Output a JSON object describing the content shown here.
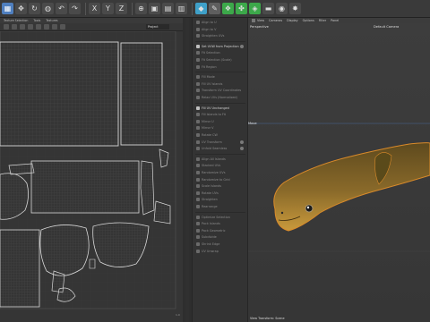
{
  "toolbar": {
    "buttons": [
      {
        "name": "select-icon",
        "glyph": "▦",
        "selected": true
      },
      {
        "name": "move-icon",
        "glyph": "✥"
      },
      {
        "name": "rotate-icon",
        "glyph": "↻"
      },
      {
        "name": "live-selection-icon",
        "glyph": "◍"
      },
      {
        "name": "undo-icon",
        "glyph": "↶"
      },
      {
        "name": "redo-icon",
        "glyph": "↷"
      },
      {
        "name": "x-axis-icon",
        "glyph": "X"
      },
      {
        "name": "y-axis-icon",
        "glyph": "Y"
      },
      {
        "name": "z-axis-icon",
        "glyph": "Z"
      },
      {
        "name": "coordinate-icon",
        "glyph": "⊕"
      },
      {
        "name": "render-view-icon",
        "glyph": "▣"
      },
      {
        "name": "render-region-icon",
        "glyph": "▤"
      },
      {
        "name": "render-settings-icon",
        "glyph": "▥"
      },
      {
        "name": "cube-icon",
        "glyph": "◆"
      },
      {
        "name": "pen-icon",
        "glyph": "✎"
      },
      {
        "name": "subdivision-icon",
        "glyph": "❖"
      },
      {
        "name": "array-icon",
        "glyph": "✤"
      },
      {
        "name": "deformer-icon",
        "glyph": "◈"
      },
      {
        "name": "floor-icon",
        "glyph": "▬"
      },
      {
        "name": "camera-icon",
        "glyph": "◉"
      },
      {
        "name": "light-icon",
        "glyph": "✸"
      }
    ],
    "accent_colors": {
      "blue": "#4f7fbf",
      "green": "#3ca84a",
      "cyan": "#3fa0c8"
    }
  },
  "uv_editor": {
    "menu": [
      "Texture Selection",
      "Tools",
      "Textures"
    ],
    "project_select": "Project",
    "status": "1.0"
  },
  "uv_commands": {
    "items": [
      {
        "label": "Align to U",
        "active": false
      },
      {
        "label": "Align to V",
        "active": false
      },
      {
        "label": "Straighten UVs",
        "active": false
      },
      {
        "label": "Set UVW from Projection",
        "active": true,
        "gear": true
      },
      {
        "label": "Fit Selection",
        "active": false
      },
      {
        "label": "Fit Selection (Scale)",
        "active": false
      },
      {
        "label": "Fit Region",
        "active": false
      },
      {
        "label": "Fill Mode",
        "active": false
      },
      {
        "label": "Fill UV Islands",
        "active": false
      },
      {
        "label": "Transform UV Coordinates",
        "active": false
      },
      {
        "label": "Relax UVs (Normalized)",
        "active": false
      },
      {
        "label": "Fill UV Unchanged",
        "active": true
      },
      {
        "label": "Fill Islands to Fit",
        "active": false
      },
      {
        "label": "Mirror U",
        "active": false
      },
      {
        "label": "Mirror V",
        "active": false
      },
      {
        "label": "Rotate CW",
        "active": false
      },
      {
        "label": "UV Transform",
        "active": false,
        "gear": true
      },
      {
        "label": "Unfold Seamless",
        "active": false,
        "gear": true
      },
      {
        "label": "Align All Islands",
        "active": false
      },
      {
        "label": "Stacked UVs",
        "active": false
      },
      {
        "label": "Randomize UVs",
        "active": false
      },
      {
        "label": "Randomize to Grid",
        "active": false
      },
      {
        "label": "Scale Islands",
        "active": false
      },
      {
        "label": "Rotate UVs",
        "active": false
      },
      {
        "label": "Straighten",
        "active": false
      },
      {
        "label": "Rearrange",
        "active": false
      },
      {
        "label": "Optimize Selection",
        "active": false
      },
      {
        "label": "Pack Islands",
        "active": false
      },
      {
        "label": "Pack Geometric",
        "active": false
      },
      {
        "label": "Subdivide",
        "active": false
      },
      {
        "label": "Shrink Edge",
        "active": false
      },
      {
        "label": "UV Unwrap",
        "active": false
      }
    ]
  },
  "viewport": {
    "menu": [
      "View",
      "Cameras",
      "Display",
      "Options",
      "Filter",
      "Panel"
    ],
    "view_label": "Perspective",
    "camera_label": "Default Camera",
    "mesh_label": "Move",
    "footer": "View Transform: Scene",
    "colors": {
      "background": "#3d3d3d",
      "fish_body": "#8a6a2a",
      "fish_belly": "#c99a3c",
      "fish_outline": "#d98a2a",
      "fish_fin": "#5a4a1a"
    }
  }
}
